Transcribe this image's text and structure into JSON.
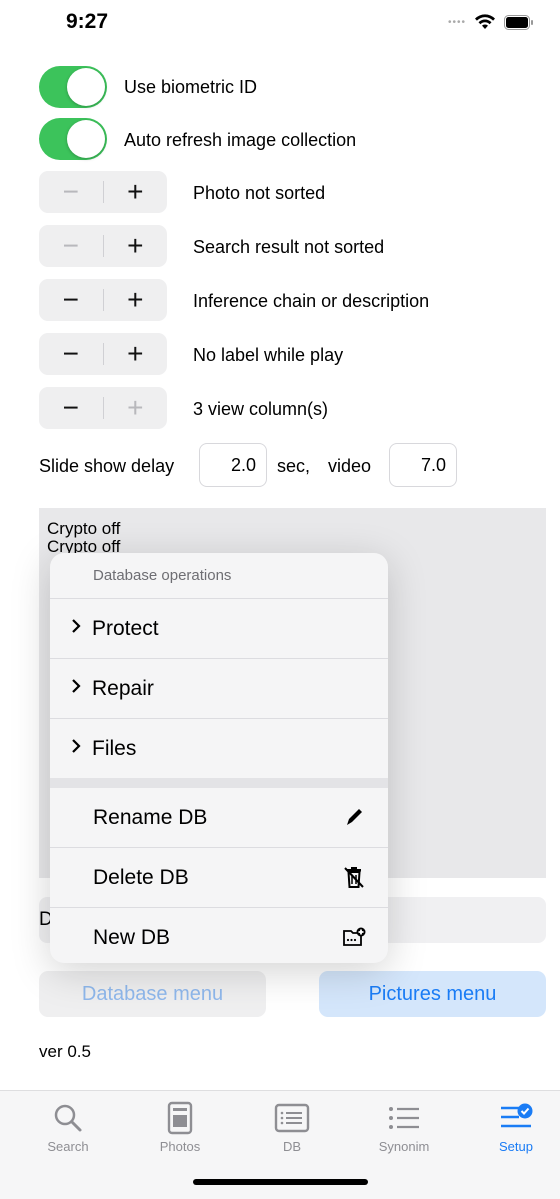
{
  "status_bar": {
    "time": "9:27"
  },
  "settings": {
    "toggles": [
      {
        "label": "Use biometric ID",
        "on": true
      },
      {
        "label": "Auto refresh image collection",
        "on": true
      }
    ],
    "steppers": [
      {
        "label": "Photo not sorted",
        "minus_enabled": false,
        "plus_enabled": true
      },
      {
        "label": "Search result not sorted",
        "minus_enabled": false,
        "plus_enabled": true
      },
      {
        "label": "Inference chain or description",
        "minus_enabled": true,
        "plus_enabled": true
      },
      {
        "label": "No label while play",
        "minus_enabled": true,
        "plus_enabled": true
      },
      {
        "label": "3 view column(s)",
        "minus_enabled": true,
        "plus_enabled": false
      }
    ],
    "stepper_minus": "−",
    "stepper_plus": "+",
    "slideshow": {
      "label": "Slide show delay",
      "delay_value": "2.0",
      "sec_label": "sec,",
      "video_label": "video",
      "video_value": "7.0"
    }
  },
  "log": {
    "lines": [
      "Crypto off",
      "Crypto off"
    ]
  },
  "db_field": {
    "visible_prefix": "D"
  },
  "popover": {
    "header": "Database operations",
    "submenus": [
      "Protect",
      "Repair",
      "Files"
    ],
    "actions": [
      {
        "label": "Rename DB",
        "icon": "pencil-icon"
      },
      {
        "label": "Delete DB",
        "icon": "trash-slash-icon"
      },
      {
        "label": "New DB",
        "icon": "folder-plus-icon"
      }
    ]
  },
  "buttons": {
    "database_menu": "Database menu",
    "pictures_menu": "Pictures menu"
  },
  "version": "ver 0.5",
  "tabs": [
    {
      "label": "Search",
      "icon": "magnifier-icon",
      "active": false
    },
    {
      "label": "Photos",
      "icon": "photo-card-icon",
      "active": false
    },
    {
      "label": "DB",
      "icon": "list-card-icon",
      "active": false
    },
    {
      "label": "Synonim",
      "icon": "list-bullet-icon",
      "active": false
    },
    {
      "label": "Setup",
      "icon": "checklist-check-icon",
      "active": true
    }
  ],
  "colors": {
    "toggle_on": "#3cc35b",
    "accent": "#1a7cf5",
    "pictures_button_bg": "#d4e6fb",
    "database_button_bg": "#efeff0"
  }
}
